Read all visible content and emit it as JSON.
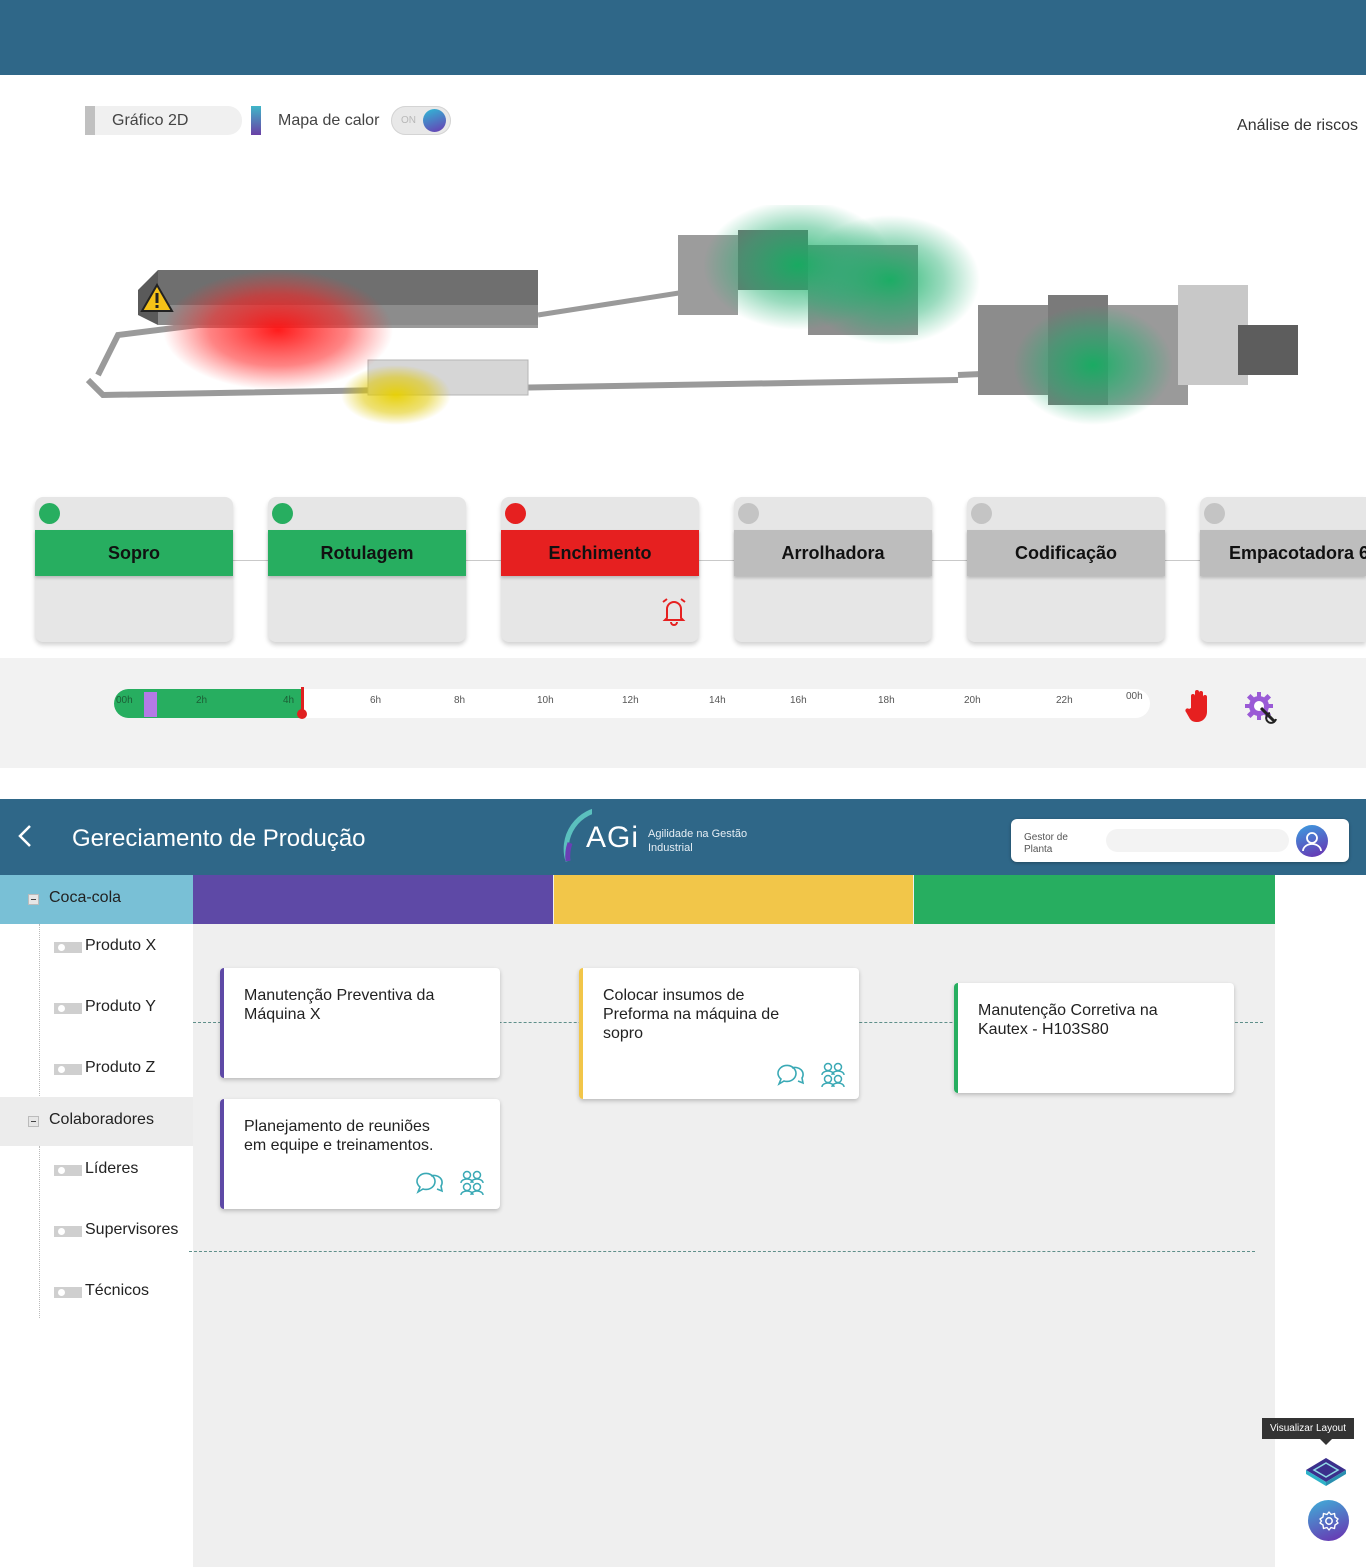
{
  "controls": {
    "graph2d_label": "Gráfico 2D",
    "heatmap_label": "Mapa de calor",
    "heatmap_switch": "ON",
    "risk_label": "Análise de riscos"
  },
  "stations": [
    {
      "name": "Sopro",
      "status": "ok",
      "color": "#27ae60"
    },
    {
      "name": "Rotulagem",
      "status": "ok",
      "color": "#27ae60"
    },
    {
      "name": "Enchimento",
      "status": "alarm",
      "color": "#e62020"
    },
    {
      "name": "Arrolhadora",
      "status": "idle",
      "color": "#bdbdbd"
    },
    {
      "name": "Codificação",
      "status": "idle",
      "color": "#bdbdbd"
    },
    {
      "name": "Empacotadora 6",
      "status": "idle",
      "color": "#bdbdbd"
    }
  ],
  "timeline": {
    "ticks": [
      "00h",
      "2h",
      "4h",
      "6h",
      "8h",
      "10h",
      "12h",
      "14h",
      "16h",
      "18h",
      "20h",
      "22h",
      "00h"
    ],
    "progress": 0.18
  },
  "production": {
    "title": "Gereciamento de Produção",
    "logo_text": "AGi",
    "logo_sub_1": "Agilidade na Gestão",
    "logo_sub_2": "Industrial",
    "user_role_1": "Gestor de",
    "user_role_2": "Planta"
  },
  "tree": {
    "group1": {
      "label": "Coca-cola",
      "items": [
        "Produto X",
        "Produto Y",
        "Produto Z"
      ]
    },
    "group2": {
      "label": "Colaboradores",
      "items": [
        "Líderes",
        "Supervisores",
        "Técnicos"
      ]
    }
  },
  "columns": [
    {
      "color": "#5e49a6"
    },
    {
      "color": "#f2c649"
    },
    {
      "color": "#27ae60"
    }
  ],
  "cards": [
    {
      "text": "Manutenção Preventiva da Máquina X",
      "color": "#5e49a6"
    },
    {
      "text": "Planejamento de reuniões em equipe e treinamentos.",
      "color": "#5e49a6"
    },
    {
      "text": "Colocar insumos de Preforma na máquina de sopro",
      "color": "#f2c649"
    },
    {
      "text": "Manutenção Corretiva na Kautex - H103S80",
      "color": "#27ae60"
    }
  ],
  "floating": {
    "tooltip": "Visualizar Layout"
  }
}
